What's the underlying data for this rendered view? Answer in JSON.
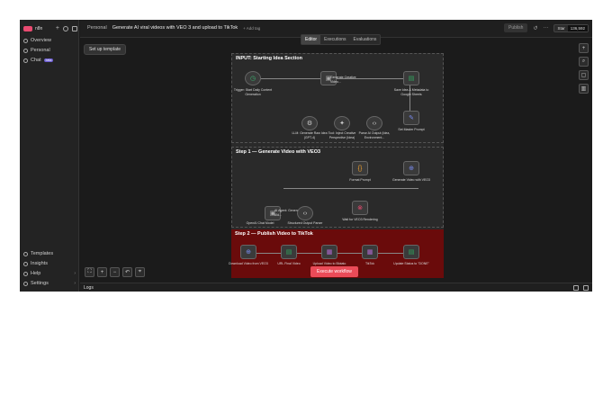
{
  "sidebar": {
    "brand": "n8n",
    "items": [
      {
        "label": "Overview"
      },
      {
        "label": "Personal"
      },
      {
        "label": "Chat",
        "badge": "beta"
      }
    ],
    "bottom": [
      {
        "label": "Templates"
      },
      {
        "label": "Insights"
      },
      {
        "label": "Help"
      },
      {
        "label": "Settings"
      }
    ]
  },
  "header": {
    "project": "Personal",
    "title": "Generate AI viral videos with VEO 3 and upload to TikTok",
    "add_tag": "+ Add tag",
    "publish": "Publish",
    "github": {
      "label": "Star",
      "count": "136,592"
    }
  },
  "tabs": [
    "Editor",
    "Executions",
    "Evaluations"
  ],
  "setup_button": "Set up template",
  "sections": [
    {
      "label": "INPUT: Starting Idea Section"
    },
    {
      "label": "Step 1 — Generate Video with VEO3"
    },
    {
      "label": "Step 2 — Publish Video to TikTok"
    }
  ],
  "nodes": {
    "trigger": "Trigger: Start Daily Content Generation",
    "generate_creative": "Generate Creative Video...",
    "save_idea": "Save Idea & Metadata to Google Sheets",
    "set_master": "Set Master Prompt",
    "llm": "LLM: Generate Raw Idea (GPT-4)",
    "tool_think": "Tool: Inject Creative Perspective (Idea)",
    "parse_ai": "Parse AI Output (Idea, Environment...",
    "format_prompt": "Format Prompt",
    "generate_veo": "Generate Video with VEO3",
    "ai_agent": "AI Agent: Generate Vid...",
    "openai_chat": "OpenAI Chat Model",
    "structured_output": "Structured Output Parser",
    "wait": "Wait for VEO3 Rendering",
    "download": "Download Video from VEO3",
    "url_final": "URL Final Video",
    "upload_blotato": "Upload Video to Blotato",
    "tiktok": "TikTok",
    "update_status": "Update Status to \"DONE\""
  },
  "execute_button": "Execute workflow",
  "logs": "Logs",
  "colors": {
    "accent": "#ea4b71",
    "execute": "#ea4b58",
    "red_section": "#6a0b0b"
  }
}
